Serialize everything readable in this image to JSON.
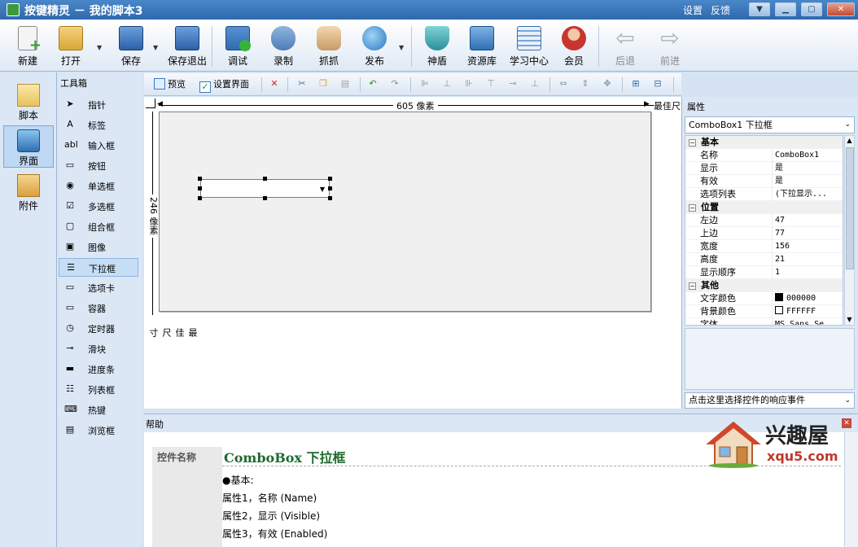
{
  "window": {
    "title": "按键精灵 － 我的脚本3",
    "links": [
      "设置",
      "反馈"
    ],
    "controls": [
      "menu",
      "minimize",
      "maximize",
      "close"
    ]
  },
  "main_toolbar": {
    "buttons": [
      {
        "label": "新建",
        "icon": "new-file-icon",
        "enabled": true
      },
      {
        "label": "打开",
        "icon": "open-folder-icon",
        "enabled": true,
        "dropdown": true
      },
      {
        "label": "保存",
        "icon": "save-icon",
        "enabled": true,
        "dropdown": true
      },
      {
        "label": "保存退出",
        "icon": "save-exit-icon",
        "enabled": true
      },
      {
        "label": "调试",
        "icon": "debug-icon",
        "enabled": true
      },
      {
        "label": "录制",
        "icon": "record-camera-icon",
        "enabled": true
      },
      {
        "label": "抓抓",
        "icon": "grab-hand-icon",
        "enabled": true
      },
      {
        "label": "发布",
        "icon": "publish-globe-icon",
        "enabled": true,
        "dropdown": true
      },
      {
        "label": "神盾",
        "icon": "shield-icon",
        "enabled": true
      },
      {
        "label": "资源库",
        "icon": "resource-library-icon",
        "enabled": true
      },
      {
        "label": "学习中心",
        "icon": "learning-center-icon",
        "enabled": true
      },
      {
        "label": "会员",
        "icon": "member-icon",
        "enabled": true
      },
      {
        "label": "后退",
        "icon": "back-arrow-icon",
        "enabled": false
      },
      {
        "label": "前进",
        "icon": "forward-arrow-icon",
        "enabled": false
      }
    ]
  },
  "left_nav": {
    "items": [
      {
        "label": "脚本",
        "icon": "script-icon",
        "active": false
      },
      {
        "label": "界面",
        "icon": "interface-icon",
        "active": true
      },
      {
        "label": "附件",
        "icon": "attachment-icon",
        "active": false
      }
    ]
  },
  "toolbox": {
    "header": "工具箱",
    "items": [
      {
        "label": "指针",
        "icon": "pointer-icon",
        "glyph": "➤"
      },
      {
        "label": "标签",
        "icon": "label-icon",
        "glyph": "A"
      },
      {
        "label": "输入框",
        "icon": "textbox-icon",
        "glyph": "abl"
      },
      {
        "label": "按钮",
        "icon": "button-icon",
        "glyph": "▭"
      },
      {
        "label": "单选框",
        "icon": "radio-icon",
        "glyph": "◉"
      },
      {
        "label": "多选框",
        "icon": "checkbox-icon",
        "glyph": "☑"
      },
      {
        "label": "组合框",
        "icon": "groupbox-icon",
        "glyph": "▢"
      },
      {
        "label": "图像",
        "icon": "image-icon",
        "glyph": "▣"
      },
      {
        "label": "下拉框",
        "icon": "combobox-icon",
        "glyph": "☰",
        "selected": true
      },
      {
        "label": "选项卡",
        "icon": "tab-icon",
        "glyph": "▭"
      },
      {
        "label": "容器",
        "icon": "container-icon",
        "glyph": "▭"
      },
      {
        "label": "定时器",
        "icon": "timer-icon",
        "glyph": "◷"
      },
      {
        "label": "滑块",
        "icon": "slider-icon",
        "glyph": "⊸"
      },
      {
        "label": "进度条",
        "icon": "progressbar-icon",
        "glyph": "▬"
      },
      {
        "label": "列表框",
        "icon": "listbox-icon",
        "glyph": "☷"
      },
      {
        "label": "热键",
        "icon": "hotkey-icon",
        "glyph": "⌨"
      },
      {
        "label": "浏览框",
        "icon": "browser-icon",
        "glyph": "▤"
      }
    ]
  },
  "edit_toolbar": {
    "preview": "预览",
    "set_interface": "设置界面"
  },
  "design": {
    "width_label": "605 像素",
    "height_label": "246 像素",
    "best_size_h": "最佳尺寸",
    "best_size_v": "最佳尺寸"
  },
  "properties": {
    "header": "属性",
    "selected_object": "ComboBox1 下拉框",
    "groups": [
      {
        "name": "基本",
        "rows": [
          {
            "name": "名称",
            "value": "ComboBox1"
          },
          {
            "name": "显示",
            "value": "是"
          },
          {
            "name": "有效",
            "value": "是"
          },
          {
            "name": "选项列表",
            "value": "(下拉显示..."
          }
        ]
      },
      {
        "name": "位置",
        "rows": [
          {
            "name": "左边",
            "value": "47"
          },
          {
            "name": "上边",
            "value": "77"
          },
          {
            "name": "宽度",
            "value": "156"
          },
          {
            "name": "高度",
            "value": "21"
          },
          {
            "name": "显示顺序",
            "value": "1"
          }
        ]
      },
      {
        "name": "其他",
        "rows": [
          {
            "name": "文字颜色",
            "value": "000000",
            "swatch": "#000000"
          },
          {
            "name": "背景颜色",
            "value": "FFFFFF",
            "swatch": "#FFFFFF"
          },
          {
            "name": "字体",
            "value": "MS Sans Se..."
          }
        ]
      }
    ],
    "events_hint": "点击这里选择控件的响应事件"
  },
  "help": {
    "header": "帮助",
    "key_label": "控件名称",
    "title": "ComboBox 下拉框",
    "lines": [
      "●基本:",
      "属性1，名称 (Name)",
      "属性2，显示 (Visible)",
      "属性3，有效 (Enabled)"
    ]
  },
  "watermark": {
    "title": "兴趣屋",
    "url": "xqu5.com"
  },
  "colors": {
    "accent": "#2e69ad",
    "panel": "#dce7f5",
    "help_title": "#1e6b2e"
  }
}
